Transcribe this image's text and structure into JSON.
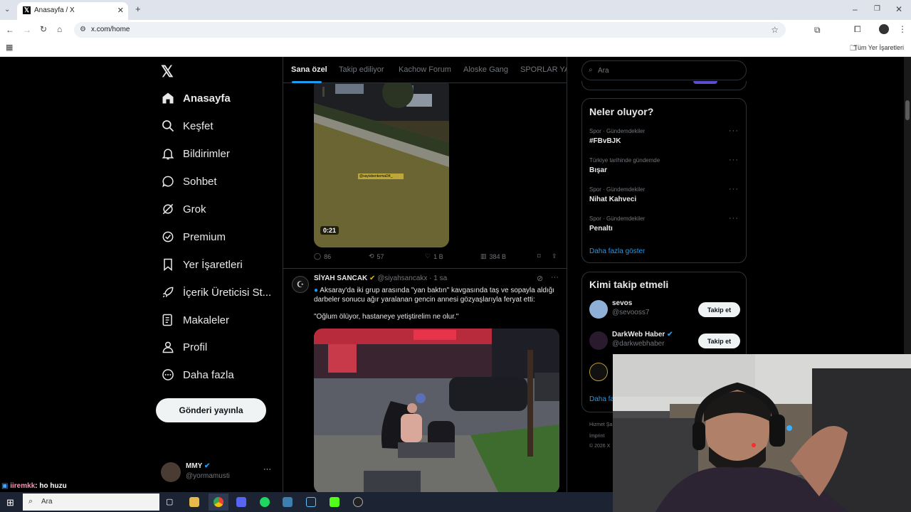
{
  "browser": {
    "tab_title": "Anasayfa / X",
    "url": "x.com/home",
    "bookmarks_label": "Tüm Yer İşaretleri"
  },
  "nav": {
    "items": [
      {
        "label": "Anasayfa",
        "icon": "home-icon"
      },
      {
        "label": "Keşfet",
        "icon": "search-icon"
      },
      {
        "label": "Bildirimler",
        "icon": "bell-icon"
      },
      {
        "label": "Sohbet",
        "icon": "chat-icon"
      },
      {
        "label": "Grok",
        "icon": "grok-icon"
      },
      {
        "label": "Premium",
        "icon": "premium-icon"
      },
      {
        "label": "Yer İşaretleri",
        "icon": "bookmark-icon"
      },
      {
        "label": "İçerik Üreticisi St...",
        "icon": "rocket-icon"
      },
      {
        "label": "Makaleler",
        "icon": "article-icon"
      },
      {
        "label": "Profil",
        "icon": "user-icon"
      },
      {
        "label": "Daha fazla",
        "icon": "more-icon"
      }
    ],
    "post_button": "Gönderi yayınla",
    "account": {
      "name": "MMY",
      "handle": "@yormamusti"
    }
  },
  "timeline": {
    "tabs": [
      "Sana özel",
      "Takip ediliyor",
      "Kachow Forum",
      "Aloske Gang",
      "SPORLAR YA"
    ],
    "tweet1": {
      "video_duration": "0:21",
      "watermark": "@sayisbenkemal34_",
      "replies": "86",
      "retweets": "57",
      "likes": "1 B",
      "views": "384 B"
    },
    "tweet2": {
      "author": "SİYAH SANCAK",
      "handle": "@siyahsancakx",
      "time": "· 1 sa",
      "text": "Aksaray'da iki grup arasında \"yan baktın\" kavgasında taş ve sopayla aldığı darbeler sonucu ağır yaralanan gencin annesi gözyaşlarıyla feryat etti:",
      "quote": "\"Oğlum ölüyor, hastaneye yetiştirelim ne olur.\""
    }
  },
  "right": {
    "search_placeholder": "Ara",
    "trends_title": "Neler oluyor?",
    "trends": [
      {
        "category": "Spor · Gündemdekiler",
        "name": "#FBvBJK"
      },
      {
        "category": "Türkiye tarihinde gündemde",
        "name": "Bışar"
      },
      {
        "category": "Spor · Gündemdekiler",
        "name": "Nihat Kahveci"
      },
      {
        "category": "Spor · Gündemdekiler",
        "name": "Penaltı"
      }
    ],
    "show_more": "Daha fazla göster",
    "wtf_title": "Kimi takip etmeli",
    "wtf": [
      {
        "name": "sevos",
        "handle": "@sevooss7",
        "button": "Takip et"
      },
      {
        "name": "DarkWeb Haber",
        "handle": "@darkwebhaber",
        "button": "Takip et"
      }
    ],
    "wtf_more": "Daha fa",
    "footer": [
      "Hizmet Şa",
      "İmprint",
      "© 2026 X"
    ]
  },
  "overlay_chat": {
    "user": "iiremkk",
    "message": ": ho huzu"
  },
  "taskbar": {
    "search": "Ara"
  }
}
